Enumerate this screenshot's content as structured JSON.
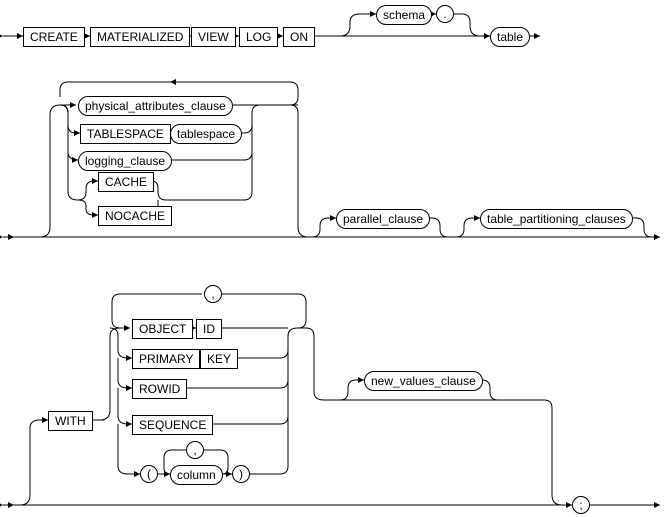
{
  "diagram_title": "CREATE MATERIALIZED VIEW LOG",
  "row1": {
    "create": "CREATE",
    "materialized": "MATERIALIZED",
    "view": "VIEW",
    "log": "LOG",
    "on": "ON",
    "schema": "schema",
    "dot": ".",
    "table": "table"
  },
  "row2": {
    "physical_attributes_clause": "physical_attributes_clause",
    "tablespace_kw": "TABLESPACE",
    "tablespace": "tablespace",
    "logging_clause": "logging_clause",
    "cache": "CACHE",
    "nocache": "NOCACHE",
    "parallel_clause": "parallel_clause",
    "table_partitioning_clauses": "table_partitioning_clauses"
  },
  "row3": {
    "with": "WITH",
    "object": "OBJECT",
    "id": "ID",
    "primary": "PRIMARY",
    "key": "KEY",
    "rowid": "ROWID",
    "sequence": "SEQUENCE",
    "comma": ",",
    "lparen": "(",
    "rparen": ")",
    "column": "column",
    "col_comma": ",",
    "new_values_clause": "new_values_clause",
    "semicolon": ";"
  },
  "chart_data": {
    "type": "railroad-diagram",
    "name": "create_materialized_view_log",
    "sequence": [
      "CREATE",
      "MATERIALIZED",
      "VIEW",
      "LOG",
      "ON",
      {
        "optional": [
          "schema",
          "."
        ]
      },
      "table",
      {
        "optional_repeat": {
          "alternatives": [
            "physical_attributes_clause",
            [
              "TABLESPACE",
              "tablespace"
            ],
            "logging_clause",
            {
              "alternatives": [
                "CACHE",
                "NOCACHE"
              ]
            }
          ]
        }
      },
      {
        "optional": "parallel_clause"
      },
      {
        "optional": "table_partitioning_clauses"
      },
      {
        "optional": [
          "WITH",
          {
            "repeat_sep": {
              "sep": ",",
              "alternatives": [
                [
                  "OBJECT",
                  "ID"
                ],
                [
                  "PRIMARY",
                  "KEY"
                ],
                "ROWID",
                "SEQUENCE",
                [
                  "(",
                  {
                    "repeat_sep": {
                      "sep": ",",
                      "item": "column"
                    }
                  },
                  ")"
                ]
              ]
            }
          },
          {
            "optional": "new_values_clause"
          }
        ]
      },
      ";"
    ]
  }
}
